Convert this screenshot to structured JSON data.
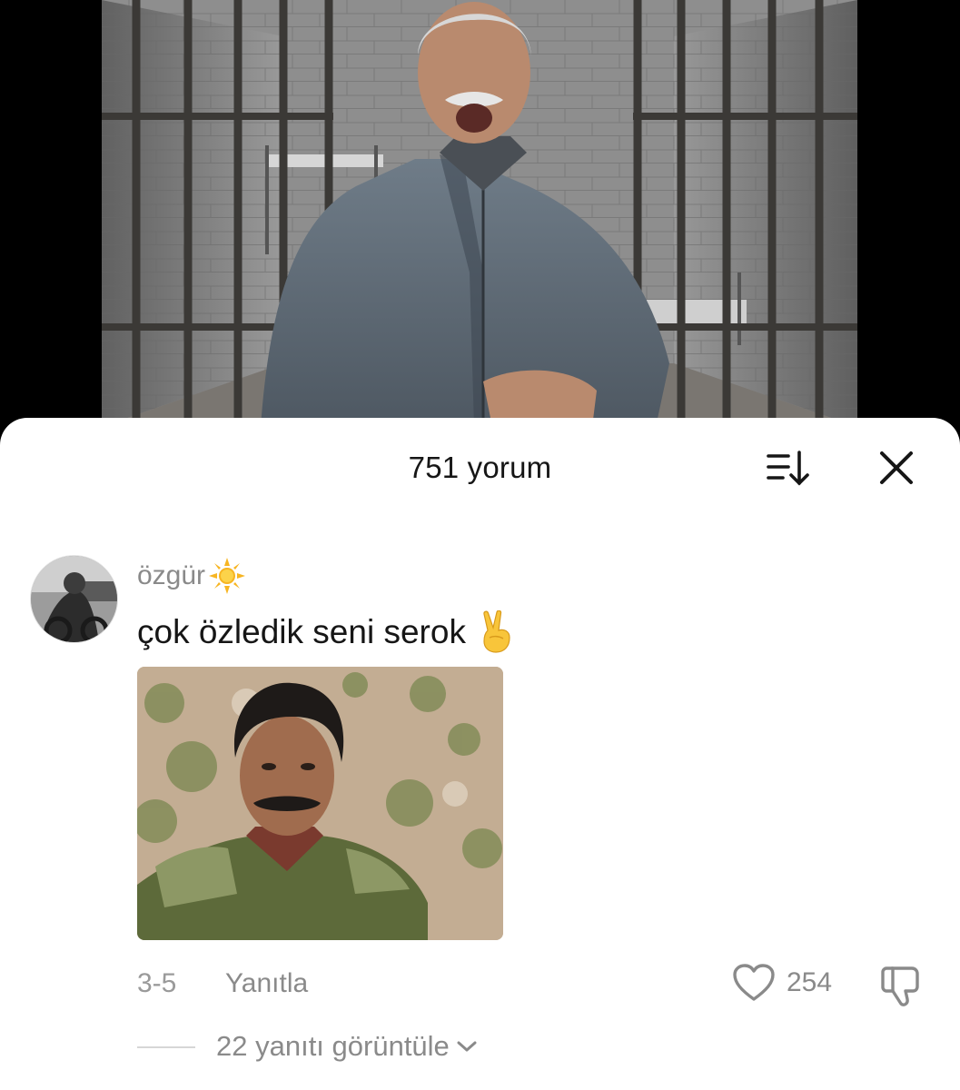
{
  "comments_sheet": {
    "title": "751 yorum",
    "sort_icon": "sort-icon",
    "close_icon": "close-icon"
  },
  "comment": {
    "username": "özgür",
    "username_emoji": "sun-emoji",
    "text": "çok özledik seni serok",
    "text_emoji": "victory-hand-emoji",
    "date": "3-5",
    "reply_label": "Yanıtla",
    "like_count": "254",
    "like_icon": "heart-icon",
    "dislike_icon": "thumbs-down-icon",
    "view_replies_label": "22 yanıtı görüntüle",
    "view_replies_icon": "chevron-down-icon"
  },
  "colors": {
    "sheet_background": "#ffffff",
    "primary_text": "#161616",
    "secondary_text": "#8a8a8a"
  }
}
